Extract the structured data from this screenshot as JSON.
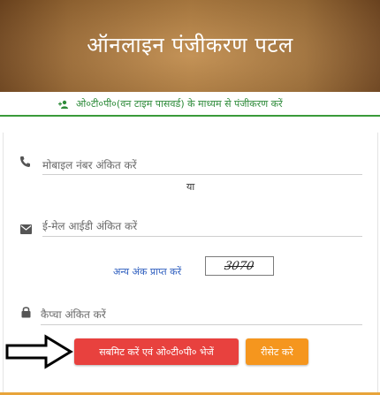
{
  "header": {
    "title": "ऑनलाइन पंजीकरण पटल"
  },
  "subheader": {
    "text": "ओ०टी०पी०(वन टाइम पासवर्ड) के माध्यम से पंजीकरण करें",
    "icon": "user-add-icon"
  },
  "form": {
    "mobile": {
      "placeholder": "मोबाइल नंबर अंकित करें",
      "value": "",
      "icon": "phone-icon"
    },
    "or_text": "या",
    "email": {
      "placeholder": "ई-मेल आईडी अंकित करें",
      "value": "",
      "icon": "mail-icon"
    },
    "captcha": {
      "link_text": "अन्य अंक प्राप्त करें",
      "code": "3070",
      "placeholder": "कैप्चा अंकित करें",
      "value": "",
      "icon": "lock-icon"
    },
    "submit_label": "सबमिट करें एवं ओ०टी०पी० भेजें",
    "reset_label": "रीसेट करे"
  },
  "colors": {
    "header_bg": "#a06e35",
    "accent_green": "#2e8b3a",
    "submit_bg": "#e8413e",
    "reset_bg": "#f5961e",
    "link": "#2f5fbf"
  }
}
